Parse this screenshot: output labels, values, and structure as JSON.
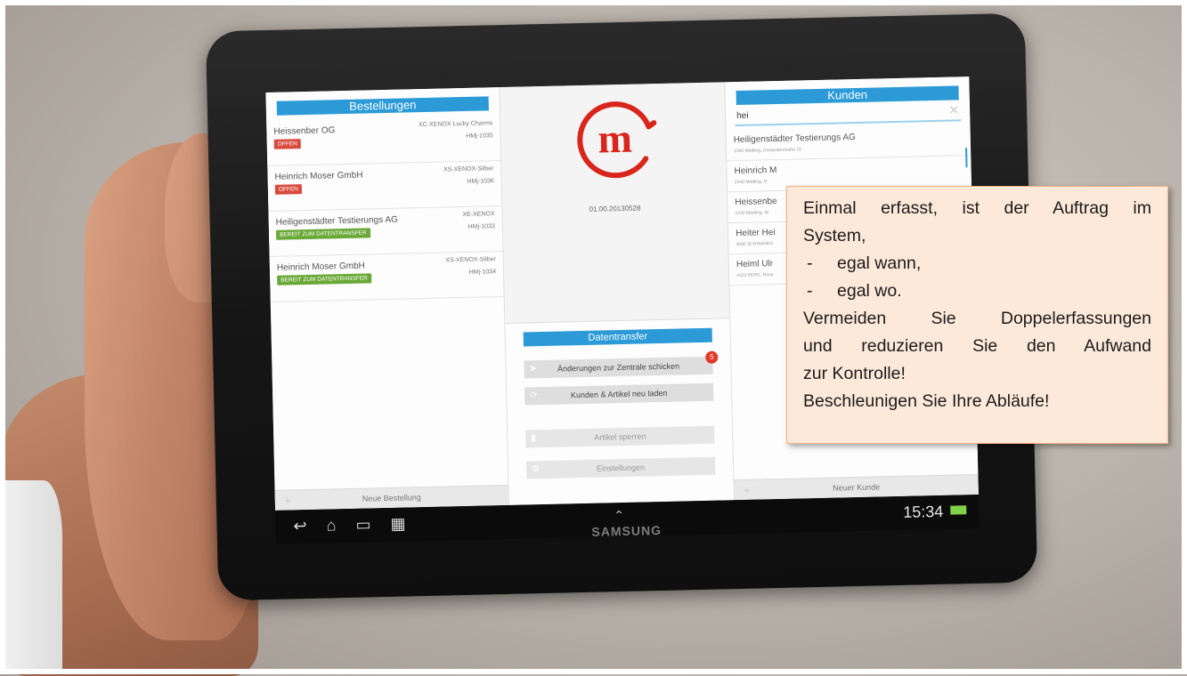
{
  "orders_panel": {
    "header": "Bestellungen",
    "orders": [
      {
        "customer": "Heissenber OG",
        "article": "XC-XENOX Lucky Charms",
        "code": "HMj-1035",
        "status": "OFFEN",
        "status_color": "#d94b3f"
      },
      {
        "customer": "Heinrich Moser GmbH",
        "article": "XS-XENOX-Silber",
        "code": "HMj-1036",
        "status": "OFFEN",
        "status_color": "#d94b3f"
      },
      {
        "customer": "Heiligenstädter Testierungs AG",
        "article": "XE-XENOX",
        "code": "HMj-1033",
        "status": "BEREIT ZUM DATENTRANSFER",
        "status_color": "#6aa838"
      },
      {
        "customer": "Heinrich Moser GmbH",
        "article": "XS-XENOX-Silber",
        "code": "HMj-1034",
        "status": "BEREIT ZUM DATENTRANSFER",
        "status_color": "#6aa838"
      }
    ],
    "new_button": "Neue Bestellung"
  },
  "center_panel": {
    "logo_letter": "m",
    "version": "01.00.20130528",
    "datentransfer": {
      "header": "Datentransfer",
      "send_changes": "Änderungen zur Zentrale schicken",
      "send_changes_badge": "5",
      "reload": "Kunden & Artikel neu laden",
      "lock": "Artikel sperren",
      "settings": "Einstellungen"
    }
  },
  "customers_panel": {
    "header": "Kunden",
    "search_query": "hei",
    "customers": [
      {
        "name": "Heiligenstädter Testierungs AG",
        "address": "2340 Mödling, Computerstraße 16"
      },
      {
        "name": "Heinrich M",
        "address": "2340 Mödling, H"
      },
      {
        "name": "Heissenbe",
        "address": "2340 Mödling, W"
      },
      {
        "name": "Heiter Hei",
        "address": "4690 SCHWANEN"
      },
      {
        "name": "Heiml Ulr",
        "address": "4323 PERG, Rose"
      }
    ],
    "new_button": "Neuer Kunde"
  },
  "system_bar": {
    "time": "15:34",
    "brand": "SAMSUNG"
  },
  "callout": {
    "line1": "Einmal erfasst, ist der Auftrag im",
    "line2": "System,",
    "bullet1": "egal wann,",
    "bullet2": "egal wo.",
    "line3": "Vermeiden Sie Doppelerfassungen",
    "line4": "und reduzieren Sie den Aufwand",
    "line5": "zur Kontrolle!",
    "line6": "Beschleunigen Sie Ihre Abläufe!",
    "dash": "-"
  },
  "colors": {
    "header_blue": "#2b9ad7",
    "logo_red": "#d8261c",
    "callout_bg": "#fde9d9",
    "callout_border": "#f4b183"
  }
}
